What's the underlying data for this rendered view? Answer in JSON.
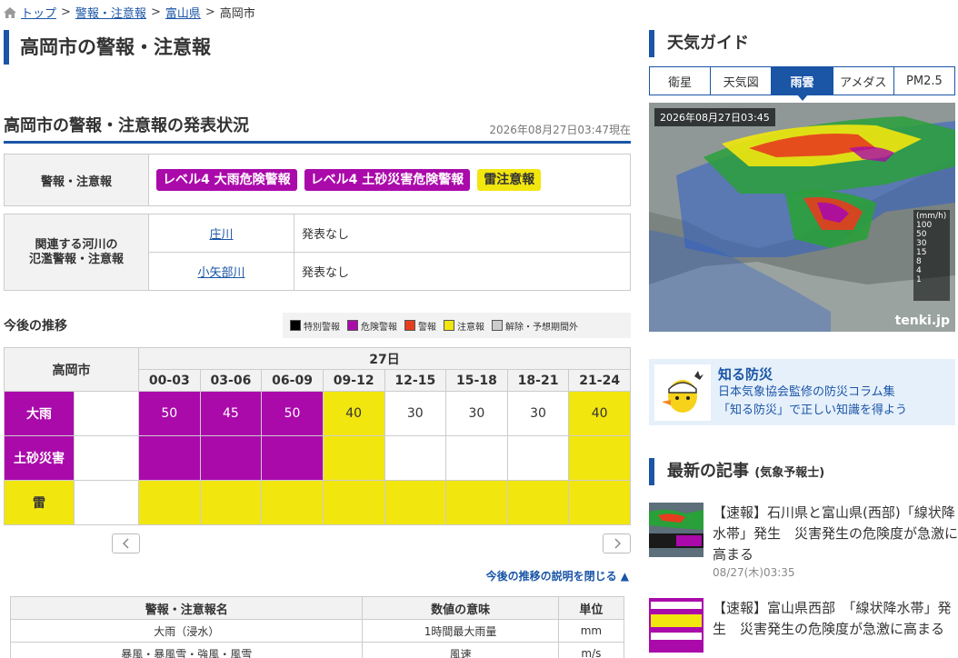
{
  "breadcrumb": {
    "home": "トップ",
    "l2": "警報・注意報",
    "l3": "富山県",
    "current": "高岡市"
  },
  "page_title": "高岡市の警報・注意報",
  "status": {
    "heading": "高岡市の警報・注意報の発表状況",
    "timestamp": "2026年08月27日03:47現在"
  },
  "warnings": {
    "label": "警報・注意報",
    "badges": [
      "レベル4 大雨危険警報",
      "レベル4 土砂災害危険警報",
      "雷注意報"
    ]
  },
  "rivers": {
    "label_line1": "関連する河川の",
    "label_line2": "氾濫警報・注意報",
    "items": [
      {
        "name": "庄川",
        "status": "発表なし"
      },
      {
        "name": "小矢部川",
        "status": "発表なし"
      }
    ]
  },
  "forecast": {
    "heading": "今後の推移",
    "legend": [
      "特別警報",
      "危険警報",
      "警報",
      "注意報",
      "解除・予想期間外"
    ],
    "legend_colors": [
      "#000000",
      "#aa0aaa",
      "#e63d1e",
      "#f2e60f",
      "#cccccc"
    ],
    "city": "高岡市",
    "day": "27日",
    "slots": [
      "00-03",
      "03-06",
      "06-09",
      "09-12",
      "12-15",
      "15-18",
      "18-21",
      "21-24"
    ],
    "rows": [
      {
        "label": "大雨",
        "values": [
          "50",
          "45",
          "50",
          "40",
          "30",
          "30",
          "30",
          "40"
        ]
      },
      {
        "label": "土砂災害",
        "values": [
          "",
          "",
          "",
          "",
          "",
          "",
          "",
          ""
        ]
      },
      {
        "label": "雷",
        "values": [
          "",
          "",
          "",
          "",
          "",
          "",
          "",
          ""
        ]
      }
    ],
    "close_label": "今後の推移の説明を閉じる ▲"
  },
  "meaning_table": {
    "headers": [
      "警報・注意報名",
      "数値の意味",
      "単位"
    ],
    "rows": [
      [
        "大雨（浸水）",
        "1時間最大雨量",
        "mm"
      ],
      [
        "暴風・暴風雪・強風・風雪",
        "風速",
        "m/s"
      ]
    ]
  },
  "weather_guide": {
    "title": "天気ガイド",
    "tabs": [
      "衛星",
      "天気図",
      "雨雲",
      "アメダス",
      "PM2.5"
    ],
    "active_tab": "雨雲",
    "radar_time": "2026年08月27日03:45",
    "scale_unit": "(mm/h)",
    "scale_values": [
      "100",
      "50",
      "30",
      "15",
      "8",
      "4",
      "1"
    ],
    "brand": "tenki.jp"
  },
  "bousai": {
    "title": "知る防災",
    "line1": "日本気象協会監修の防災コラム集",
    "line2": "「知る防災」で正しい知識を得よう"
  },
  "news": {
    "title": "最新の記事",
    "title_sub": "(気象予報士)",
    "items": [
      {
        "title": "【速報】石川県と富山県(西部)「線状降水帯」発生　災害発生の危険度が急激に高まる",
        "date": "08/27(木)03:35"
      },
      {
        "title": "【速報】富山県西部　「線状降水帯」発生　災害発生の危険度が急激に高まる",
        "date": ""
      }
    ]
  }
}
